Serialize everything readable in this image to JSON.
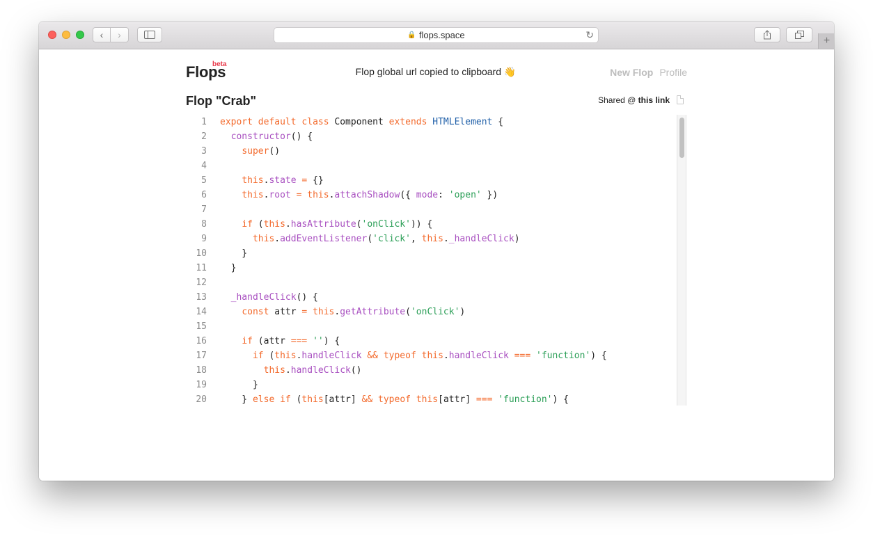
{
  "browser": {
    "url": "flops.space",
    "back_glyph": "‹",
    "forward_glyph": "›",
    "lock_glyph": "🔒",
    "reload_glyph": "↻",
    "plus_glyph": "+"
  },
  "header": {
    "logo": "Flops",
    "badge": "beta",
    "toast": "Flop global url copied to clipboard",
    "toast_emoji": "👋",
    "nav": {
      "new_flop": "New Flop",
      "profile": "Profile"
    }
  },
  "flop": {
    "title": "Flop \"Crab\"",
    "shared_prefix": "Shared @ ",
    "shared_link": "this link"
  },
  "colors": {
    "keyword": "#f36a2c",
    "function": "#a84fc0",
    "string": "#2a9e56",
    "class": "#1f5fa8",
    "badge": "#e8394a"
  },
  "code": {
    "language": "javascript",
    "lines": [
      "export default class Component extends HTMLElement {",
      "  constructor() {",
      "    super()",
      "",
      "    this.state = {}",
      "    this.root = this.attachShadow({ mode: 'open' })",
      "",
      "    if (this.hasAttribute('onClick')) {",
      "      this.addEventListener('click', this._handleClick)",
      "    }",
      "  }",
      "",
      "  _handleClick() {",
      "    const attr = this.getAttribute('onClick')",
      "",
      "    if (attr === '') {",
      "      if (this.handleClick && typeof this.handleClick === 'function') {",
      "        this.handleClick()",
      "      }",
      "    } else if (this[attr] && typeof this[attr] === 'function') {"
    ]
  }
}
